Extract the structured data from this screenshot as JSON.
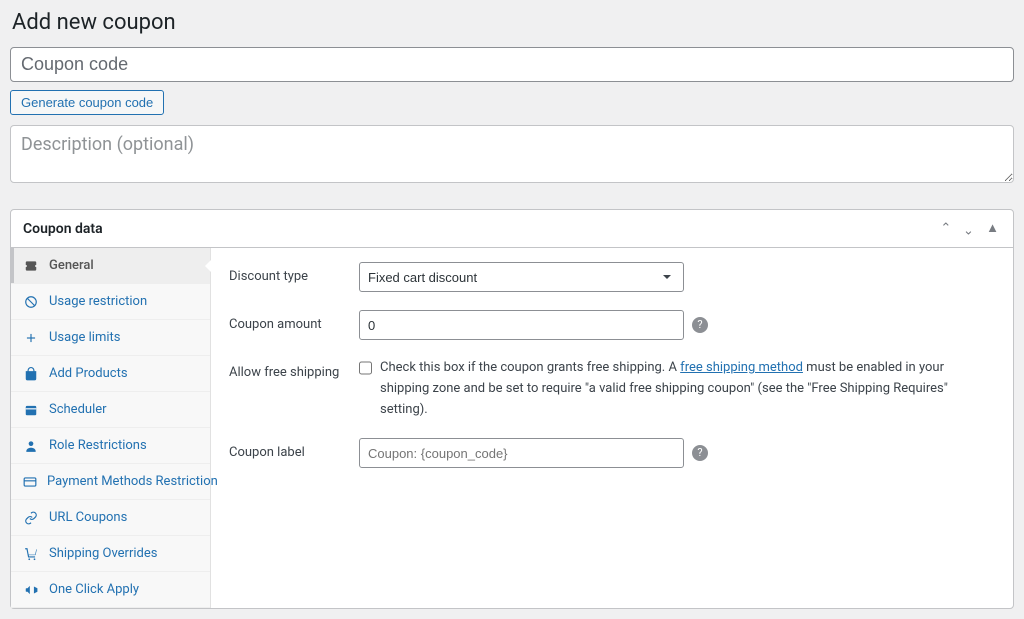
{
  "page": {
    "title": "Add new coupon"
  },
  "coupon_code": {
    "placeholder": "Coupon code",
    "value": ""
  },
  "generate_button_label": "Generate coupon code",
  "description": {
    "placeholder": "Description (optional)",
    "value": ""
  },
  "panel": {
    "title": "Coupon data"
  },
  "sidebar": {
    "items": [
      {
        "label": "General",
        "icon": "ticket",
        "active": true
      },
      {
        "label": "Usage restriction",
        "icon": "ban",
        "active": false
      },
      {
        "label": "Usage limits",
        "icon": "plus",
        "active": false
      },
      {
        "label": "Add Products",
        "icon": "bag",
        "active": false
      },
      {
        "label": "Scheduler",
        "icon": "calendar",
        "active": false
      },
      {
        "label": "Role Restrictions",
        "icon": "user",
        "active": false
      },
      {
        "label": "Payment Methods Restriction",
        "icon": "card",
        "active": false
      },
      {
        "label": "URL Coupons",
        "icon": "link",
        "active": false
      },
      {
        "label": "Shipping Overrides",
        "icon": "cart",
        "active": false
      },
      {
        "label": "One Click Apply",
        "icon": "announce",
        "active": false
      }
    ]
  },
  "form": {
    "discount_type": {
      "label": "Discount type",
      "selected": "Fixed cart discount"
    },
    "coupon_amount": {
      "label": "Coupon amount",
      "value": "0"
    },
    "free_shipping": {
      "label": "Allow free shipping",
      "checked": false,
      "text_before": "Check this box if the coupon grants free shipping. A ",
      "link_text": "free shipping method",
      "text_after": " must be enabled in your shipping zone and be set to require \"a valid free shipping coupon\" (see the \"Free Shipping Requires\" setting)."
    },
    "coupon_label": {
      "label": "Coupon label",
      "placeholder": "Coupon: {coupon_code}",
      "value": ""
    }
  }
}
